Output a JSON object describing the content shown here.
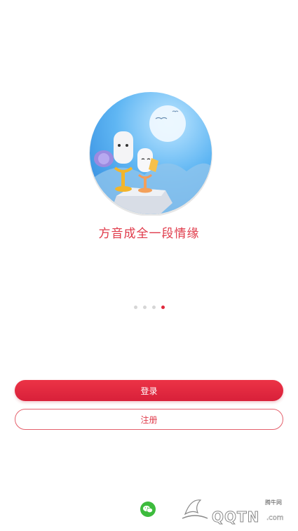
{
  "onboarding": {
    "slogan": "方音成全一段情缘",
    "page_count": 4,
    "active_page": 4
  },
  "actions": {
    "login_label": "登录",
    "register_label": "注册"
  },
  "social": {
    "wechat_icon": "wechat-icon"
  },
  "watermark": {
    "small_text": "腾牛网",
    "brand_text": "QQTN",
    "suffix": ".com"
  },
  "colors": {
    "accent": "#e0283c",
    "dot_inactive": "#d6d6d6",
    "wechat_green": "#3dbb3d"
  }
}
